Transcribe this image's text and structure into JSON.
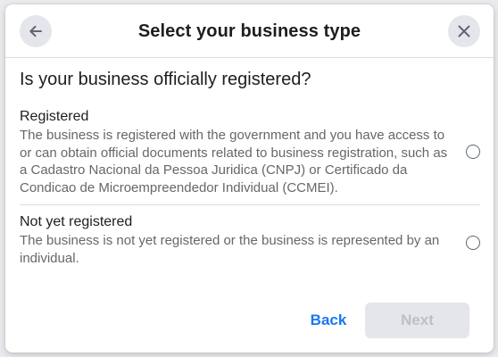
{
  "dialog": {
    "title": "Select your business type",
    "back_icon": "arrow-left-icon",
    "close_icon": "close-icon"
  },
  "question": "Is your business officially registered?",
  "options": [
    {
      "title": "Registered",
      "description": "The business is registered with the government and you have access to or can obtain official documents related to business registration, such as a Cadastro Nacional da Pessoa Juridica (CNPJ) or Certificado da Condicao de Microempreendedor Individual (CCMEI).",
      "selected": false
    },
    {
      "title": "Not yet registered",
      "description": "The business is not yet registered or the business is represented by an individual.",
      "selected": false
    }
  ],
  "footer": {
    "back_label": "Back",
    "next_label": "Next",
    "next_disabled": true
  },
  "colors": {
    "accent": "#1877f2",
    "text_primary": "#1c1e21",
    "text_secondary": "#65676b",
    "disabled_bg": "#e4e6eb",
    "disabled_text": "#bcc0c4"
  }
}
